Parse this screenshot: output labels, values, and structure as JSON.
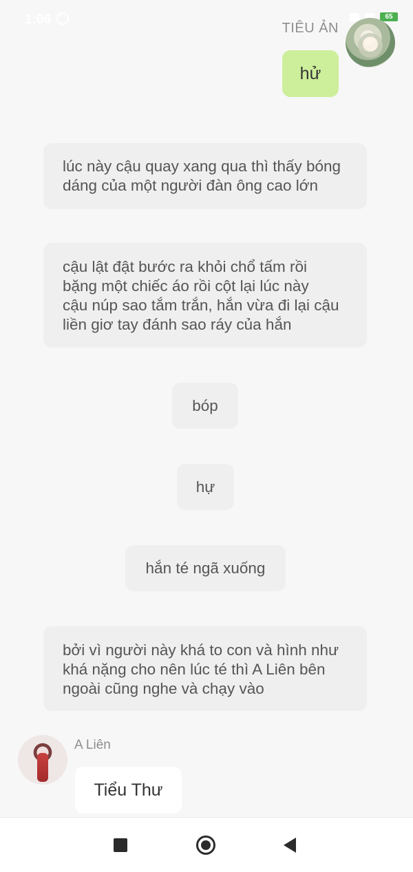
{
  "status_bar": {
    "time": "1:06",
    "battery": "65"
  },
  "header": {
    "right_sender_name": "TIÊU ẢN"
  },
  "messages": {
    "outgoing_1": "hử",
    "narration_1": "lúc này cậu quay xang qua thì thấy bóng\ndáng của một người đàn ông cao lớn",
    "narration_2": "cậu lật đật bước ra khỏi chổ tấm rồi\nbặng một chiếc áo rồi cột lại lúc này\ncậu núp sao tắm trắn, hắn vừa đi lại cậu\nliền giơ tay đánh sao ráy của hắn",
    "narration_3": "bóp",
    "narration_4": "hự",
    "narration_5": "hắn té ngã xuống",
    "narration_6": "bởi vì người này khá to con và hình như\nkhá nặng cho nên lúc té thì A Liên bên\nngoài cũng nghe và chạy vào",
    "left_sender_name": "A Liên",
    "incoming_1": "Tiểu Thư"
  },
  "icons": {
    "recents": "square-icon",
    "home": "home-circle-icon",
    "back": "back-triangle-icon",
    "alarm": "alarm-icon"
  }
}
